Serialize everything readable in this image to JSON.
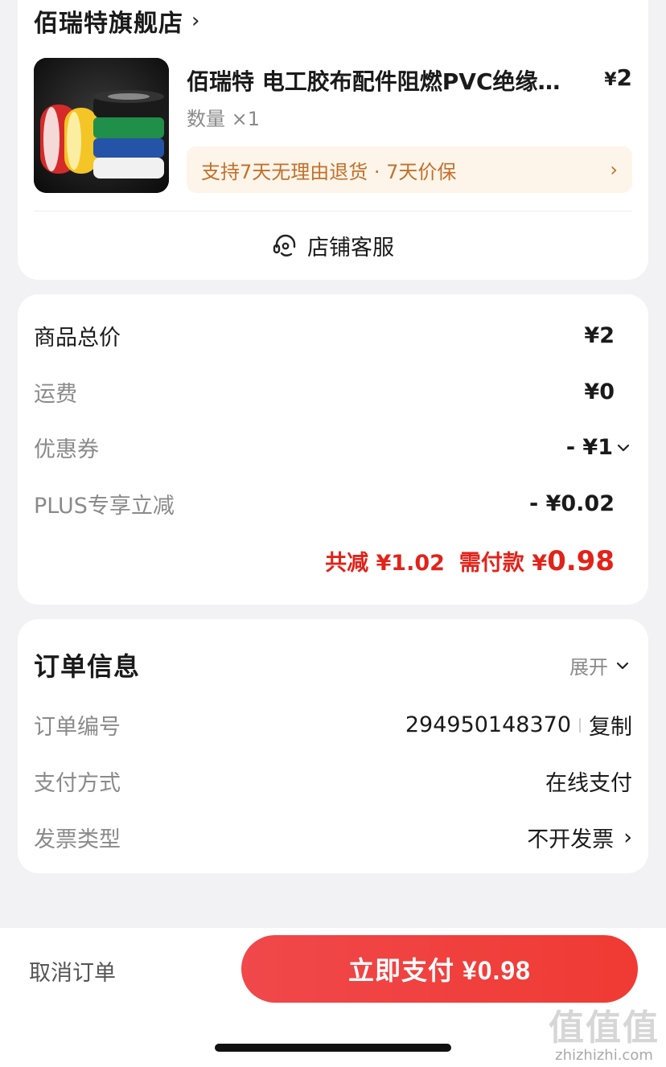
{
  "store": {
    "name": "佰瑞特旗舰店",
    "chevron": "›",
    "product": {
      "name": "佰瑞特 电工胶布配件阻燃PVC绝缘胶带",
      "price_symbol": "¥",
      "price": "2",
      "quantity": "数量 ×1",
      "promise": "支持7天无理由退货 · 7天价保",
      "promise_chevron": "›",
      "image_icon": "electrical-tape-product-image"
    },
    "service_label": "店铺客服",
    "service_icon": "headset-icon"
  },
  "price_details": {
    "rows": [
      {
        "label": "商品总价",
        "value": "¥2"
      },
      {
        "label": "运费",
        "value": "¥0"
      },
      {
        "label": "优惠券",
        "value": "- ¥1"
      },
      {
        "label": "PLUS专享立减",
        "value": "- ¥0.02"
      }
    ],
    "summary_reduce": "共减 ¥1.02",
    "summary_pay_label": "需付款 ¥",
    "summary_pay_value": "0.98"
  },
  "order_info": {
    "title": "订单信息",
    "expand_label": "展开",
    "rows": [
      {
        "label": "订单编号",
        "value": "294950148370",
        "action": "复制"
      },
      {
        "label": "支付方式",
        "value": "在线支付"
      },
      {
        "label": "发票类型",
        "value": "不开发票",
        "chevron": "›"
      }
    ]
  },
  "bottom_bar": {
    "cancel_label": "取消订单",
    "pay_label": "立即支付 ¥0.98"
  },
  "watermark": {
    "big": "值值值",
    "small": "zhizhizhi.com"
  },
  "colors": {
    "accent_red": "#e2231a",
    "pay_button": "#f0433e",
    "promise_bg": "#fdf5ea",
    "promise_text": "#c2702a",
    "page_bg": "#f2f2f4"
  }
}
